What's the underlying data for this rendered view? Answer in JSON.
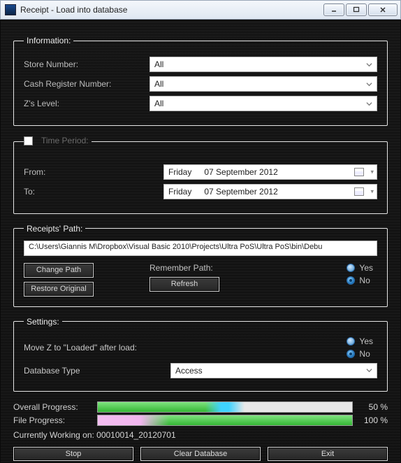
{
  "window": {
    "title": "Receipt - Load into database"
  },
  "information": {
    "legend": "Information:",
    "store_label": "Store Number:",
    "store_value": "All",
    "register_label": "Cash Register Number:",
    "register_value": "All",
    "zlevel_label": "Z's Level:",
    "zlevel_value": "All"
  },
  "time_period": {
    "legend": "Time Period:",
    "from_label": "From:",
    "from_day": "Friday",
    "from_date": "07 September 2012",
    "to_label": "To:",
    "to_day": "Friday",
    "to_date": "07 September 2012"
  },
  "receipts_path": {
    "legend": "Receipts' Path:",
    "path": "C:\\Users\\Giannis M\\Dropbox\\Visual Basic 2010\\Projects\\Ultra PoS\\Ultra PoS\\bin\\Debu",
    "change_path": "Change Path",
    "restore_original": "Restore Original",
    "refresh": "Refresh",
    "remember_label": "Remember Path:",
    "yes": "Yes",
    "no": "No"
  },
  "settings": {
    "legend": "Settings:",
    "movez_label": "Move Z to \"Loaded\" after load:",
    "yes": "Yes",
    "no": "No",
    "dbtype_label": "Database Type",
    "dbtype_value": "Access"
  },
  "progress": {
    "overall_label": "Overall Progress:",
    "overall_pct": "50 %",
    "file_label": "File Progress:",
    "file_pct": "100 %",
    "working_prefix": "Currently Working on: ",
    "working_file": "00010014_20120701"
  },
  "footer": {
    "stop": "Stop",
    "clear": "Clear Database",
    "exit": "Exit"
  }
}
